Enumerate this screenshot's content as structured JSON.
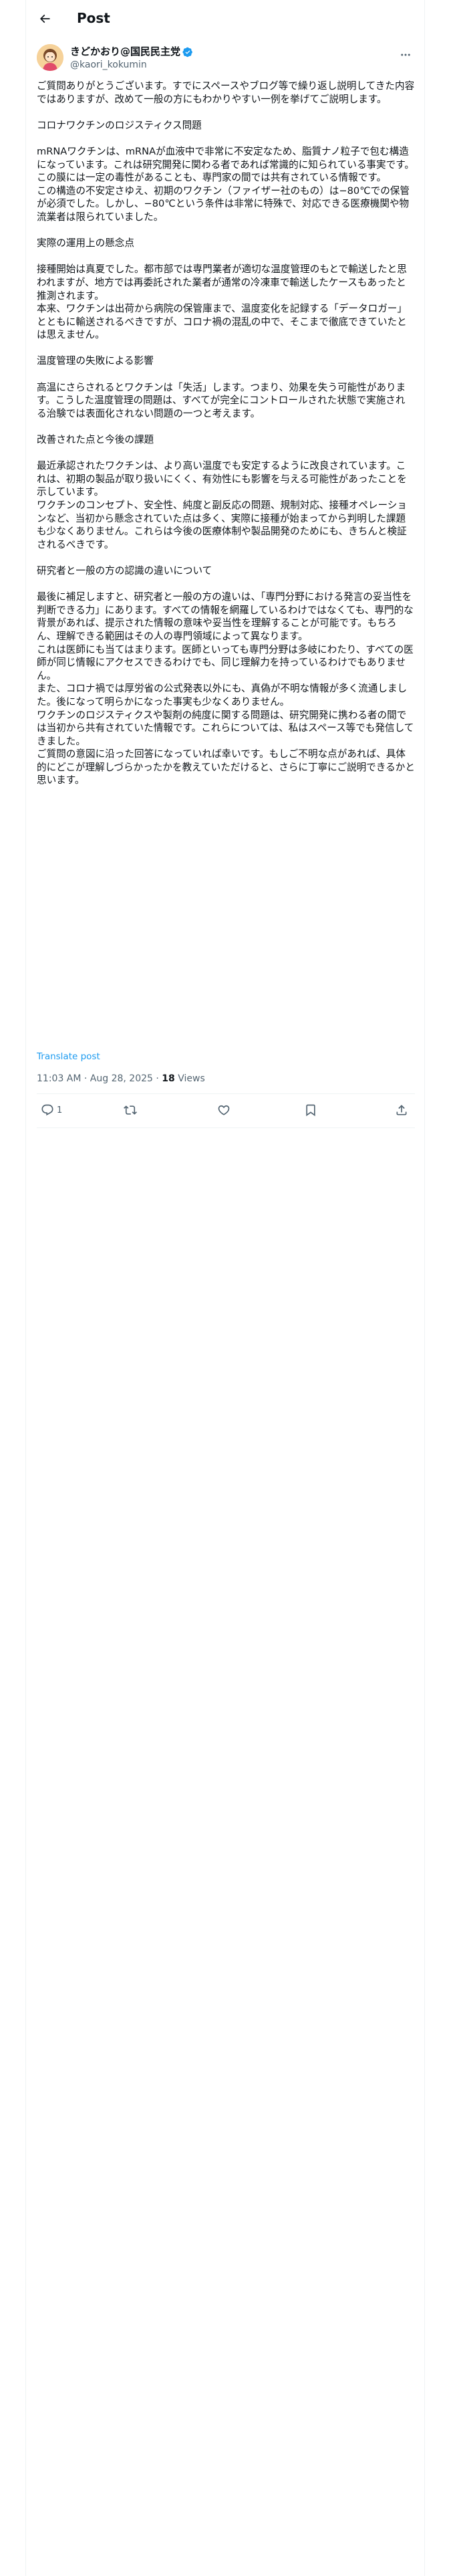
{
  "header": {
    "title": "Post"
  },
  "author": {
    "display_name": "きどかおり@国民民主党",
    "handle": "@kaori_kokumin",
    "verified_color": "#1d9bf0",
    "avatar_icon": "avatar-illustration"
  },
  "post": {
    "text": "ご質問ありがとうございます。すでにスペースやブログ等で繰り返し説明してきた内容ではありますが、改めて一般の方にもわかりやすい一例を挙げてご説明します。\n\nコロナワクチンのロジスティクス問題\n\nmRNAワクチンは、mRNAが血液中で非常に不安定なため、脂質ナノ粒子で包む構造になっています。これは研究開発に関わる者であれば常識的に知られている事実です。この膜には一定の毒性があることも、専門家の間では共有されている情報です。\nこの構造の不安定さゆえ、初期のワクチン（ファイザー社のもの）は−80℃での保管が必須でした。しかし、−80℃という条件は非常に特殊で、対応できる医療機関や物流業者は限られていました。\n\n実際の運用上の懸念点\n\n接種開始は真夏でした。都市部では専門業者が適切な温度管理のもとで輸送したと思われますが、地方では再委託された業者が通常の冷凍車で輸送したケースもあったと推測されます。\n本来、ワクチンは出荷から病院の保管庫まで、温度変化を記録する「データロガー」とともに輸送されるべきですが、コロナ禍の混乱の中で、そこまで徹底できていたとは思えません。\n\n温度管理の失敗による影響\n\n高温にさらされるとワクチンは「失活」します。つまり、効果を失う可能性があります。こうした温度管理の問題は、すべてが完全にコントロールされた状態で実施される治験では表面化されない問題の一つと考えます。\n\n改善された点と今後の課題\n\n最近承認されたワクチンは、より高い温度でも安定するように改良されています。これは、初期の製品が取り扱いにくく、有効性にも影響を与える可能性があったことを示しています。\nワクチンのコンセプト、安全性、純度と副反応の問題、規制対応、接種オペレーションなど、当初から懸念されていた点は多く、実際に接種が始まってから判明した課題も少なくありません。これらは今後の医療体制や製品開発のためにも、きちんと検証されるべきです。\n\n研究者と一般の方の認識の違いについて\n\n最後に補足しますと、研究者と一般の方の違いは、「専門分野における発言の妥当性を判断できる力」にあります。すべての情報を網羅しているわけではなくても、専門的な背景があれば、提示された情報の意味や妥当性を理解することが可能です。もちろん、理解できる範囲はその人の専門領域によって異なります。\nこれは医師にも当てはまります。医師といっても専門分野は多岐にわたり、すべての医師が同じ情報にアクセスできるわけでも、同じ理解力を持っているわけでもありません。\nまた、コロナ禍では厚労省の公式発表以外にも、真偽が不明な情報が多く流通しました。後になって明らかになった事実も少なくありません。\nワクチンのロジスティクスや製剤の純度に関する問題は、研究開発に携わる者の間では当初から共有されていた情報です。これらについては、私はスペース等でも発信してきました。\nご質問の意図に沿った回答になっていれば幸いです。もしご不明な点があれば、具体的にどこが理解しづらかったかを教えていただけると、さらに丁寧にご説明できるかと思います。",
    "translate_label": "Translate post",
    "time": "11:03 AM · Aug 28, 2025",
    "sep": " · ",
    "views_count": "18",
    "views_label": " Views"
  },
  "actions": {
    "reply_count": "1",
    "reply_icon": "reply-icon",
    "repost_icon": "repost-icon",
    "like_icon": "heart-icon",
    "bookmark_icon": "bookmark-icon",
    "share_icon": "share-icon"
  }
}
